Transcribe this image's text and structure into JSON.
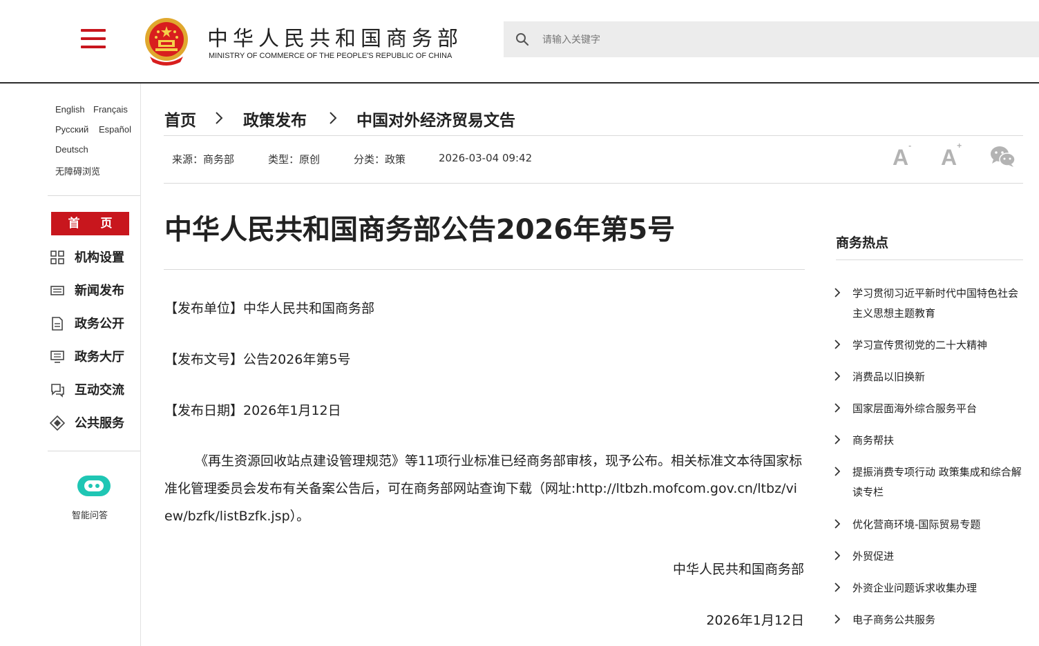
{
  "header": {
    "title_cn": "中华人民共和国商务部",
    "title_en": "MINISTRY OF COMMERCE OF THE PEOPLE'S REPUBLIC OF CHINA",
    "search_placeholder": "请输入关键字"
  },
  "languages": [
    "English",
    "Français",
    "Русский",
    "Español",
    "Deutsch",
    "无障碍浏览"
  ],
  "nav": {
    "home": "首 页",
    "items": [
      {
        "label": "机构设置",
        "icon": "grid-icon"
      },
      {
        "label": "新闻发布",
        "icon": "newspaper-icon"
      },
      {
        "label": "政务公开",
        "icon": "document-icon"
      },
      {
        "label": "政务大厅",
        "icon": "monitor-icon"
      },
      {
        "label": "互动交流",
        "icon": "chat-icon"
      },
      {
        "label": "公共服务",
        "icon": "service-icon"
      }
    ],
    "assistant_label": "智能问答"
  },
  "breadcrumb": [
    "首页",
    "政策发布",
    "中国对外经济贸易文告"
  ],
  "meta": {
    "source": "来源：商务部",
    "type": "类型：原创",
    "category": "分类：政策",
    "datetime": "2026-03-04 09:42",
    "font_large": "A",
    "font_small": "A"
  },
  "article": {
    "title": "中华人民共和国商务部公告2026年第5号",
    "issuer": "【发布单位】中华人民共和国商务部",
    "doc_number": "【发布文号】公告2026年第5号",
    "date": "【发布日期】2026年1月12日",
    "body": "《再生资源回收站点建设管理规范》等11项行业标准已经商务部审核，现予公布。相关标准文本待国家标准化管理委员会发布有关备案公告后，可在商务部网站查询下载（网址:http://ltbzh.mofcom.gov.cn/ltbz/view/bzfk/listBzfk.jsp）。",
    "signature": "中华人民共和国商务部",
    "signature_date": "2026年1月12日"
  },
  "hot": {
    "title": "商务热点",
    "items": [
      "学习贯彻习近平新时代中国特色社会主义思想主题教育",
      "学习宣传贯彻党的二十大精神",
      "消费品以旧换新",
      "国家层面海外综合服务平台",
      "商务帮扶",
      "提振消费专项行动 政策集成和综合解读专栏",
      "优化营商环境-国际贸易专题",
      "外贸促进",
      "外资企业问题诉求收集办理",
      "电子商务公共服务"
    ]
  },
  "colors": {
    "accent": "#c8161d",
    "header_line": "#2b2b2b",
    "search_bg": "#ececec",
    "muted_icon": "#b3b3b3"
  }
}
